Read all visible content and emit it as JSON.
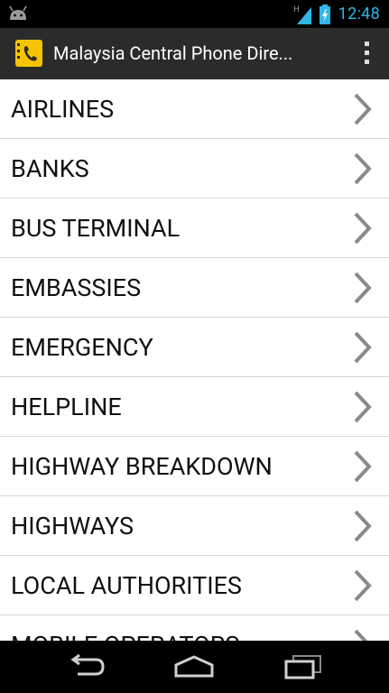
{
  "status_bar": {
    "time": "12:48",
    "network_type": "H",
    "icons": [
      "android-debug-icon",
      "signal-icon",
      "battery-charging-icon"
    ],
    "accent_color": "#33b5e5"
  },
  "action_bar": {
    "title": "Malaysia Central Phone Dire...",
    "app_icon": "phone-book-icon",
    "overflow_icon": "overflow-menu-icon"
  },
  "list": {
    "items": [
      {
        "label": "AIRLINES"
      },
      {
        "label": "BANKS"
      },
      {
        "label": "BUS TERMINAL"
      },
      {
        "label": "EMBASSIES"
      },
      {
        "label": "EMERGENCY"
      },
      {
        "label": "HELPLINE"
      },
      {
        "label": "HIGHWAY BREAKDOWN"
      },
      {
        "label": "HIGHWAYS"
      },
      {
        "label": "LOCAL AUTHORITIES"
      },
      {
        "label": "MOBILE OPERATORS"
      }
    ],
    "chevron_icon": "chevron-right-icon"
  },
  "nav_bar": {
    "buttons": [
      "back-icon",
      "home-icon",
      "recent-apps-icon"
    ]
  }
}
